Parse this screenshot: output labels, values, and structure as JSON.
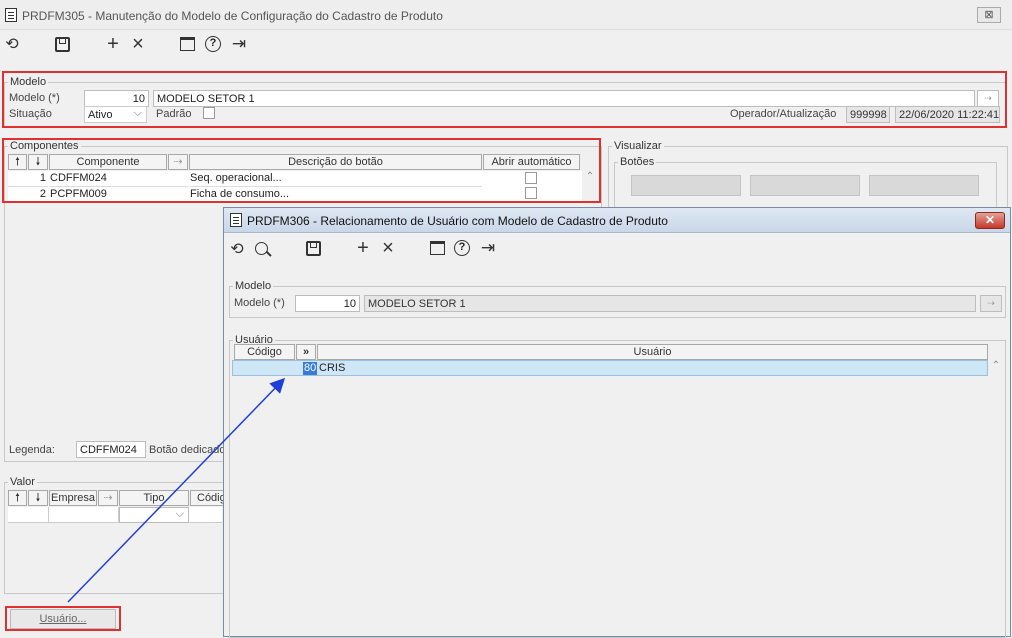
{
  "main_window": {
    "title": "PRDFM305 - Manutenção do Modelo de Configuração do Cadastro de Produto",
    "close_symbol": "⊠",
    "toolbar": {
      "undo_icon": "⟲",
      "save_icon": "💾",
      "add_icon": "+",
      "delete_icon": "×",
      "calendar_icon": "📅",
      "help_icon": "?",
      "exit_icon": "⇥"
    },
    "modelo": {
      "legend": "Modelo",
      "modelo_label": "Modelo (*)",
      "modelo_value": "10",
      "modelo_desc": "MODELO SETOR 1",
      "situacao_label": "Situação",
      "situacao_value": "Ativo",
      "padrao_label": "Padrão",
      "operador_label": "Operador/Atualização",
      "operador_value": "999998",
      "atualizacao_value": "22/06/2020 11:22:41"
    },
    "componentes": {
      "legend": "Componentes",
      "headers": [
        "Componente",
        "Descrição do botão",
        "Abrir automático"
      ],
      "rows": [
        {
          "num": "1",
          "componente": "CDFFM024",
          "descricao": "Seq. operacional..."
        },
        {
          "num": "2",
          "componente": "PCPFM009",
          "descricao": "Ficha de consumo..."
        }
      ],
      "legenda_label": "Legenda:",
      "legenda_value": "CDFFM024",
      "botao_text": "Botão dedicado"
    },
    "visualizar": {
      "legend": "Visualizar",
      "botoes_legend": "Botões"
    },
    "valor": {
      "legend": "Valor",
      "headers": [
        "Empresa",
        "Tipo",
        "Código"
      ]
    },
    "usuario_button": "Usuário..."
  },
  "popup": {
    "title": "PRDFM306 - Relacionamento de Usuário com Modelo de Cadastro de Produto",
    "close_symbol": "✕",
    "modelo": {
      "legend": "Modelo",
      "label": "Modelo (*)",
      "value": "10",
      "desc": "MODELO SETOR 1"
    },
    "usuario": {
      "legend": "Usuário",
      "headers": [
        "Código",
        "»",
        "Usuário"
      ],
      "rows": [
        {
          "codigo": "80",
          "usuario": "CRIS"
        }
      ]
    }
  },
  "colors": {
    "highlight_red": "#e03030",
    "arrow_blue": "#1f3fd8",
    "row_selected": "#cfe6f7"
  }
}
